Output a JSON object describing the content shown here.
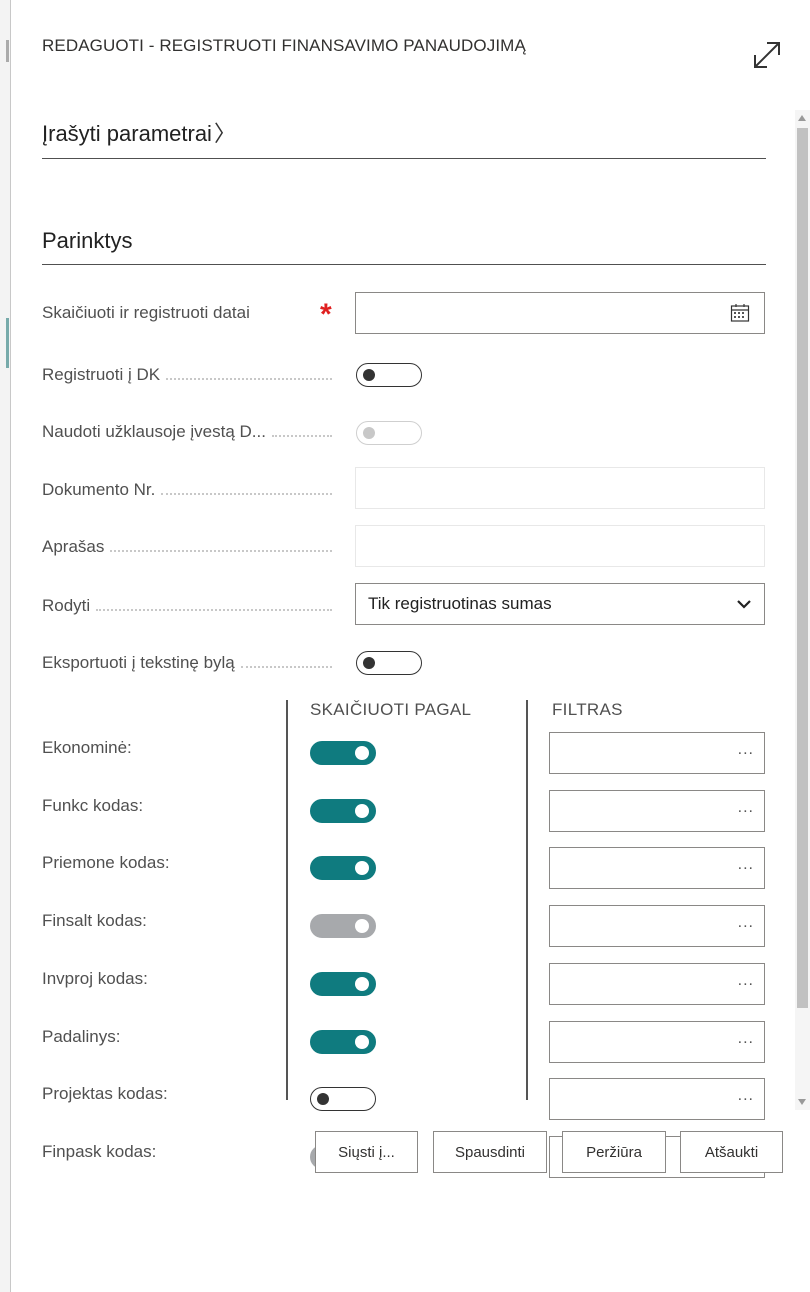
{
  "dialog": {
    "title": "REDAGUOTI - REGISTRUOTI FINANSAVIMO PANAUDOJIMĄ"
  },
  "sections": {
    "saved_params": "Įrašyti parametrai",
    "options": "Parinktys"
  },
  "fields": {
    "posting_date": {
      "label": "Skaičiuoti ir registruoti datai",
      "value": "",
      "required": true
    },
    "post_to_gl": {
      "label": "Registruoti į DK",
      "state": "off"
    },
    "use_query_date": {
      "label": "Naudoti užklausoje įvestą D...",
      "state": "off-disabled"
    },
    "document_no": {
      "label": "Dokumento Nr.",
      "value": ""
    },
    "description": {
      "label": "Aprašas",
      "value": ""
    },
    "show": {
      "label": "Rodyti",
      "selected": "Tik registruotinas sumas"
    },
    "export_text": {
      "label": "Eksportuoti į tekstinę bylą",
      "state": "off"
    }
  },
  "columns": {
    "calc_by": "SKAIČIUOTI PAGAL",
    "filter": "FILTRAS"
  },
  "dimensions": [
    {
      "label": "Ekonominė:",
      "state": "on",
      "filter": ""
    },
    {
      "label": "Funkc kodas:",
      "state": "on",
      "filter": ""
    },
    {
      "label": "Priemone kodas:",
      "state": "on",
      "filter": ""
    },
    {
      "label": "Finsalt kodas:",
      "state": "on-disabled",
      "filter": ""
    },
    {
      "label": "Invproj kodas:",
      "state": "on",
      "filter": ""
    },
    {
      "label": "Padalinys:",
      "state": "on",
      "filter": ""
    },
    {
      "label": "Projektas kodas:",
      "state": "off",
      "filter": ""
    },
    {
      "label": "Finpask kodas:",
      "state": "on-disabled",
      "filter": ""
    }
  ],
  "ellipsis": "...",
  "buttons": {
    "send": "Siųsti į...",
    "print": "Spausdinti",
    "preview": "Peržiūra",
    "cancel": "Atšaukti"
  },
  "colors": {
    "toggle_on": "#0f7b7f",
    "toggle_on_disabled": "#a7a9ac",
    "required": "#e02020"
  }
}
